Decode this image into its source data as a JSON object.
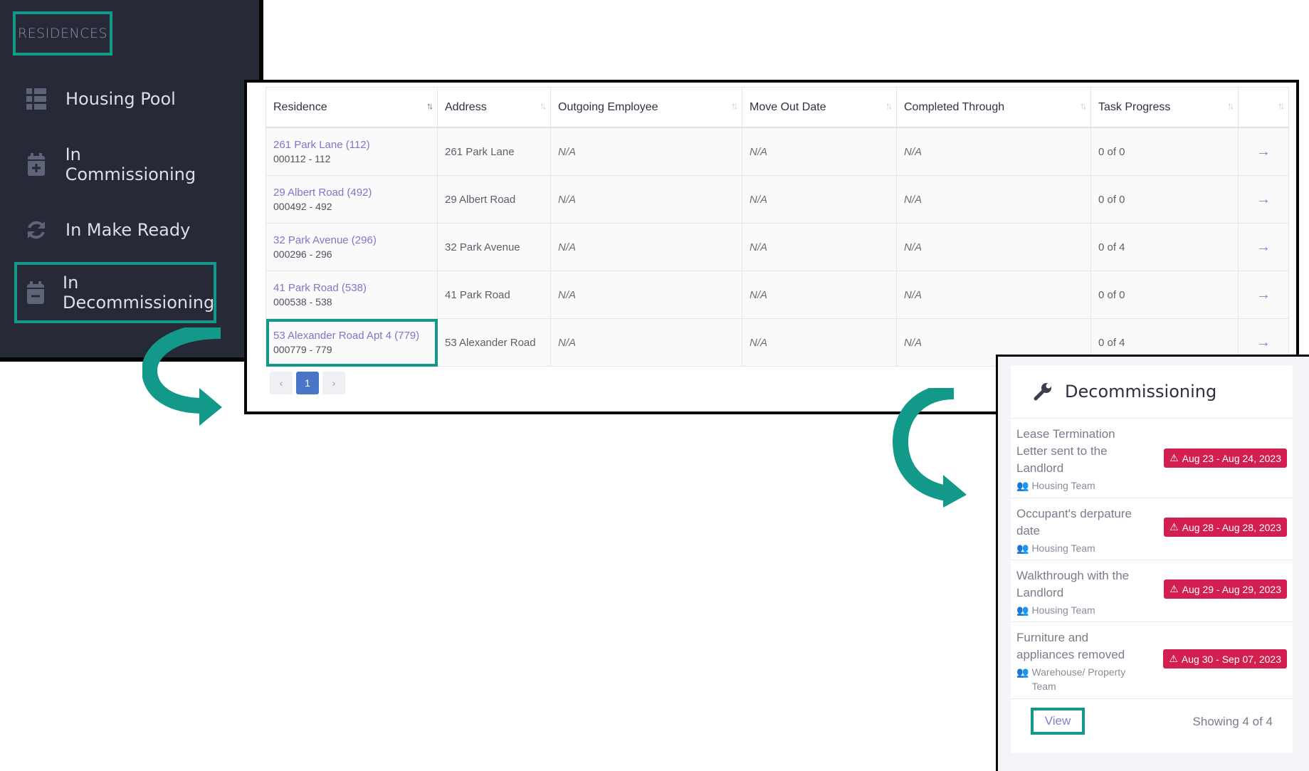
{
  "sidebar": {
    "heading": "RESIDENCES",
    "items": [
      {
        "label": "Housing Pool",
        "icon": "list-icon"
      },
      {
        "label": "In Commissioning",
        "icon": "calendar-plus-icon"
      },
      {
        "label": "In Make Ready",
        "icon": "refresh-icon"
      },
      {
        "label": "In Decommissioning",
        "icon": "calendar-minus-icon",
        "active": true
      }
    ]
  },
  "table": {
    "headers": [
      "Residence",
      "Address",
      "Outgoing Employee",
      "Move Out Date",
      "Completed Through",
      "Task Progress",
      ""
    ],
    "rows": [
      {
        "residence": "261 Park Lane (112)",
        "code": "000112 - 112",
        "address": "261 Park Lane",
        "employee": "N/A",
        "move_out": "N/A",
        "completed": "N/A",
        "progress": "0 of 0"
      },
      {
        "residence": "29 Albert Road (492)",
        "code": "000492 - 492",
        "address": "29 Albert Road",
        "employee": "N/A",
        "move_out": "N/A",
        "completed": "N/A",
        "progress": "0 of 0"
      },
      {
        "residence": "32 Park Avenue (296)",
        "code": "000296 - 296",
        "address": "32 Park Avenue",
        "employee": "N/A",
        "move_out": "N/A",
        "completed": "N/A",
        "progress": "0 of 4"
      },
      {
        "residence": "41 Park Road (538)",
        "code": "000538 - 538",
        "address": "41 Park Road",
        "employee": "N/A",
        "move_out": "N/A",
        "completed": "N/A",
        "progress": "0 of 0"
      },
      {
        "residence": "53 Alexander Road Apt 4 (779)",
        "code": "000779 - 779",
        "address": "53 Alexander Road",
        "employee": "N/A",
        "move_out": "N/A",
        "completed": "N/A",
        "progress": "0 of 4"
      }
    ],
    "row_arrow": "→",
    "pager": {
      "prev": "‹",
      "current": "1",
      "next": "›"
    }
  },
  "decommissioning": {
    "title": "Decommissioning",
    "tasks": [
      {
        "name": "Lease Termination Letter sent to the Landlord",
        "team": "Housing Team",
        "dates": "Aug 23 - Aug 24, 2023"
      },
      {
        "name": "Occupant's derpature date",
        "team": "Housing Team",
        "dates": "Aug 28 - Aug 28, 2023"
      },
      {
        "name": "Walkthrough with the Landlord",
        "team": "Housing Team",
        "dates": "Aug 29 - Aug 29, 2023"
      },
      {
        "name": "Furniture and appliances removed",
        "team": "Warehouse/ Property Team",
        "dates": "Aug 30 - Sep 07, 2023"
      }
    ],
    "view_label": "View",
    "showing": "Showing 4 of 4"
  },
  "colors": {
    "highlight": "#13998a",
    "badge": "#d21f50",
    "sidebar_bg": "#262a36",
    "link": "#7d77c8"
  }
}
